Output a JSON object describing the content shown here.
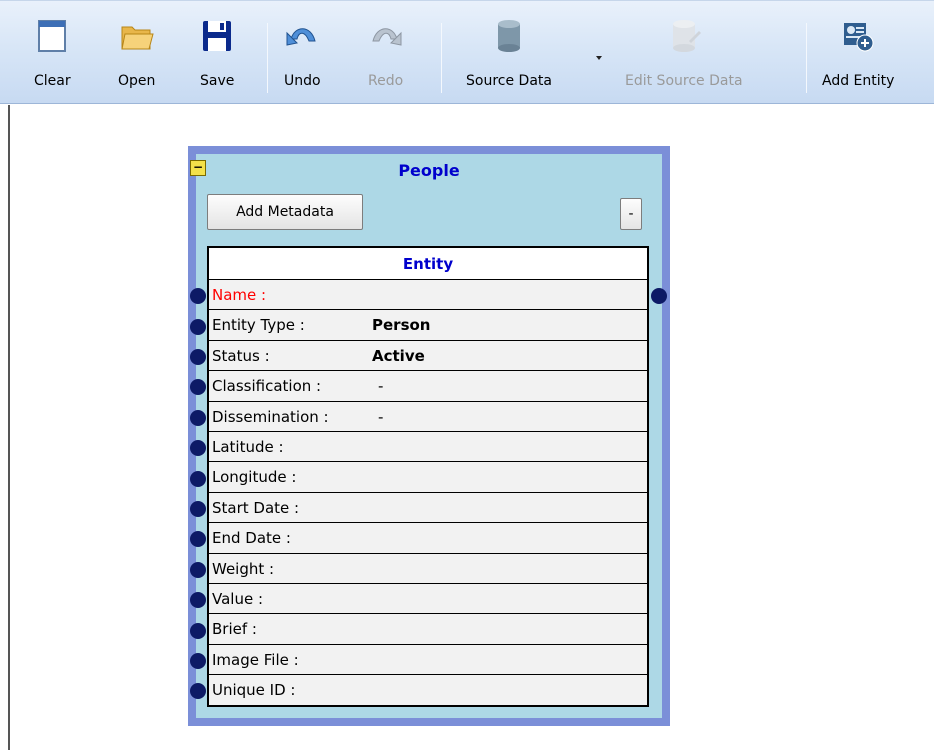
{
  "toolbar": {
    "buttons": [
      {
        "label": "Clear",
        "icon": "clear-page-icon"
      },
      {
        "label": "Open",
        "icon": "folder-open-icon"
      },
      {
        "label": "Save",
        "icon": "floppy-save-icon"
      },
      {
        "label": "Undo",
        "icon": "undo-arrow-icon"
      },
      {
        "label": "Redo",
        "icon": "redo-arrow-icon",
        "disabled": true
      },
      {
        "label": "Source Data",
        "icon": "database-icon"
      },
      {
        "label": "Edit Source Data",
        "icon": "database-edit-icon",
        "disabled": true
      },
      {
        "label": "Add Entity",
        "icon": "add-entity-icon"
      }
    ]
  },
  "entity_node": {
    "title": "People",
    "collapse_glyph": "−",
    "add_metadata_label": "Add Metadata",
    "minus_label": "-",
    "table_header": "Entity",
    "rows": [
      {
        "key": "Name :",
        "value": ""
      },
      {
        "key": "Entity Type :",
        "value": "Person"
      },
      {
        "key": "Status :",
        "value": "Active"
      },
      {
        "key": "Classification :",
        "value": "-"
      },
      {
        "key": "Dissemination :",
        "value": "-"
      },
      {
        "key": "Latitude :",
        "value": ""
      },
      {
        "key": "Longitude :",
        "value": ""
      },
      {
        "key": "Start Date :",
        "value": ""
      },
      {
        "key": "End Date :",
        "value": ""
      },
      {
        "key": "Weight :",
        "value": ""
      },
      {
        "key": "Value :",
        "value": ""
      },
      {
        "key": "Brief :",
        "value": ""
      },
      {
        "key": "Image File :",
        "value": ""
      },
      {
        "key": "Unique ID :",
        "value": ""
      }
    ]
  },
  "colors": {
    "node_border": "#7b8fd8",
    "node_fill": "#add8e6",
    "title_blue": "#0000cc",
    "required_red": "#ff0000",
    "port": "#0d1a66"
  }
}
